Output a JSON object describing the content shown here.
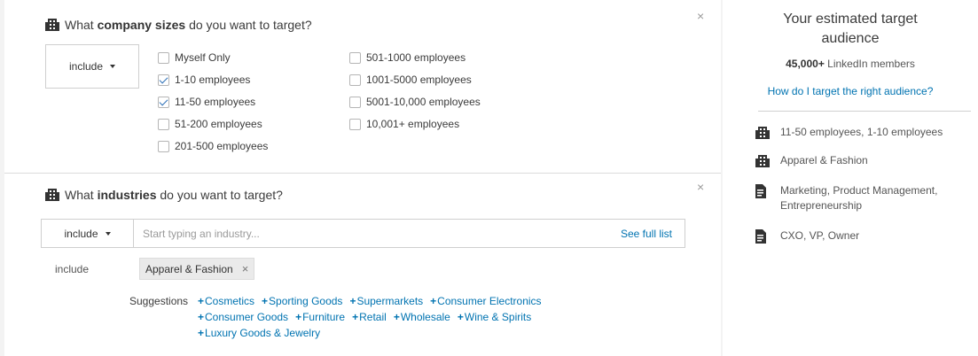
{
  "company_sizes": {
    "title_prefix": "What ",
    "title_bold": "company sizes",
    "title_suffix": " do you want to target?",
    "close": "×",
    "include_label": "include",
    "col1": [
      {
        "label": "Myself Only",
        "checked": false
      },
      {
        "label": "1-10 employees",
        "checked": true
      },
      {
        "label": "11-50 employees",
        "checked": true
      },
      {
        "label": "51-200 employees",
        "checked": false
      },
      {
        "label": "201-500 employees",
        "checked": false
      }
    ],
    "col2": [
      {
        "label": "501-1000 employees",
        "checked": false
      },
      {
        "label": "1001-5000 employees",
        "checked": false
      },
      {
        "label": "5001-10,000 employees",
        "checked": false
      },
      {
        "label": "10,001+ employees",
        "checked": false
      }
    ]
  },
  "industries": {
    "title_prefix": "What ",
    "title_bold": "industries",
    "title_suffix": " do you want to target?",
    "close": "×",
    "include_label": "include",
    "placeholder": "Start typing an industry...",
    "see_full_list": "See full list",
    "selected_label": "include",
    "selected": [
      {
        "label": "Apparel & Fashion",
        "remove": "×"
      }
    ],
    "suggestions_label": "Suggestions",
    "suggestions": [
      "Cosmetics",
      "Sporting Goods",
      "Supermarkets",
      "Consumer Electronics",
      "Consumer Goods",
      "Furniture",
      "Retail",
      "Wholesale",
      "Wine & Spirits",
      "Luxury Goods & Jewelry"
    ]
  },
  "audience": {
    "title_line1": "Your estimated target",
    "title_line2": "audience",
    "count": "45,000+",
    "count_suffix": " LinkedIn members",
    "help_link": "How do I target the right audience?",
    "summary": [
      {
        "icon": "building-icon",
        "text_line1": "11-50 employees, 1-10 employees",
        "text_line2": ""
      },
      {
        "icon": "building-icon",
        "text_line1": "Apparel & Fashion",
        "text_line2": ""
      },
      {
        "icon": "document-icon",
        "text_line1": "Marketing, Product Management,",
        "text_line2": "Entrepreneurship"
      },
      {
        "icon": "document-icon",
        "text_line1": "CXO, VP, Owner",
        "text_line2": ""
      }
    ]
  },
  "colors": {
    "link": "#0073b1",
    "checkmark": "#2c6fb7",
    "text": "#3b3b3b",
    "background": "#f3f3f3"
  }
}
